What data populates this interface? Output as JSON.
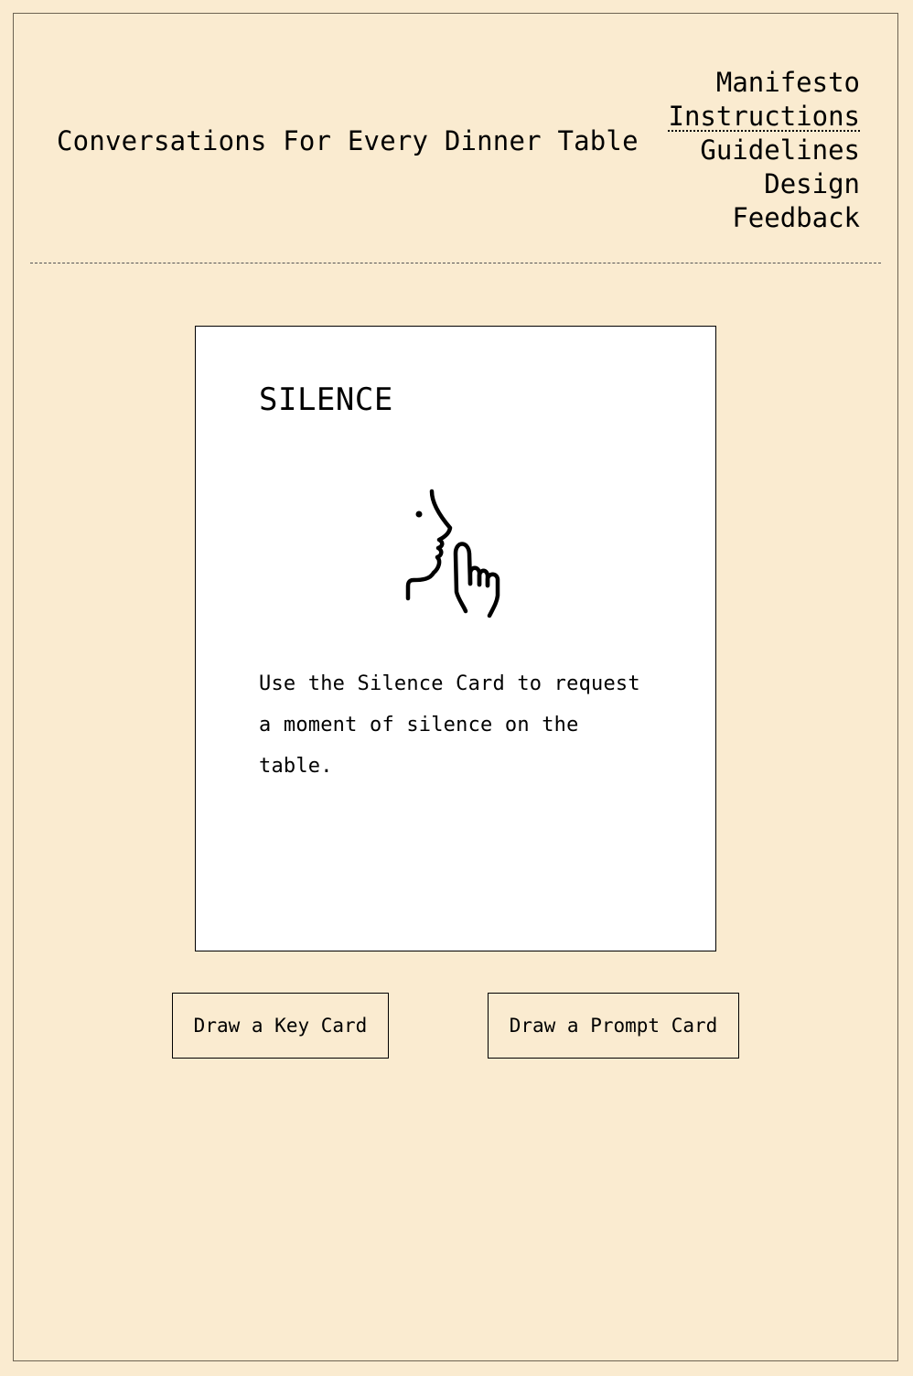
{
  "header": {
    "title": "Conversations For Every Dinner Table"
  },
  "nav": {
    "items": [
      {
        "label": "Manifesto"
      },
      {
        "label": "Instructions",
        "active": true
      },
      {
        "label": "Guidelines"
      },
      {
        "label": "Design"
      },
      {
        "label": "Feedback"
      }
    ]
  },
  "card": {
    "title": "SILENCE",
    "icon": "silence-shush-icon",
    "text": "Use the Silence Card to request a moment of silence on the table."
  },
  "actions": {
    "key_card_label": "Draw a Key Card",
    "prompt_card_label": "Draw a Prompt Card"
  },
  "colors": {
    "background": "#faebd0",
    "card": "#ffffff",
    "text": "#000000"
  }
}
